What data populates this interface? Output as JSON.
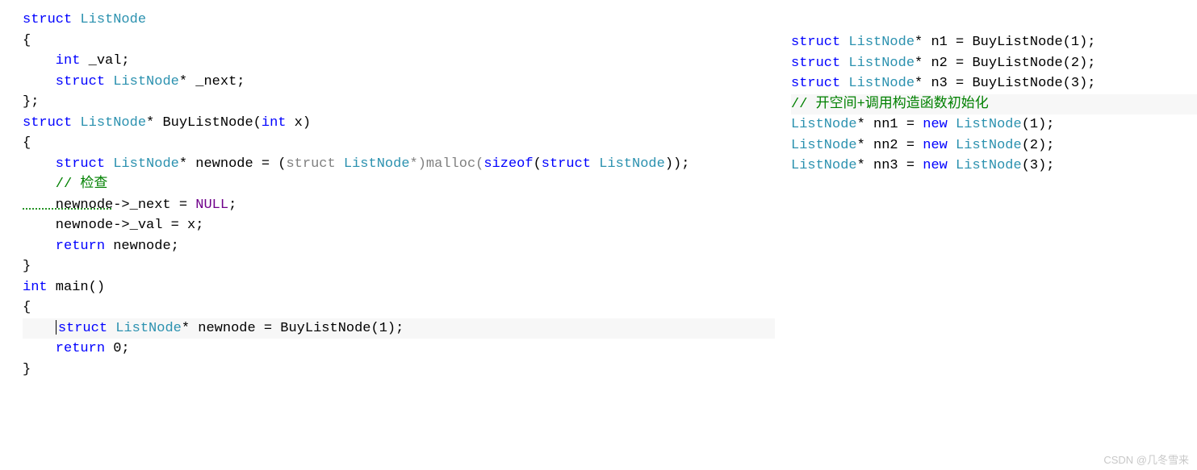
{
  "left": {
    "l1_kw": "struct",
    "l1_type": " ListNode",
    "l2": "{",
    "l3_kw": "    int",
    "l3_rest": " _val;",
    "l4_kw": "    struct",
    "l4_type": " ListNode",
    "l4_rest": "* _next;",
    "l5": "};",
    "l6": "",
    "l7_kw": "struct",
    "l7_type": " ListNode",
    "l7_rest1": "* BuyListNode(",
    "l7_kw2": "int",
    "l7_rest2": " x)",
    "l8": "{",
    "l9_kw": "    struct",
    "l9_type": " ListNode",
    "l9_rest1": "* newnode = (",
    "l9_kw2": "struct",
    "l9_type2": " ListNode",
    "l9_rest2": "*)malloc(",
    "l9_sizeof": "sizeof",
    "l9_rest3": "(",
    "l9_kw3": "struct",
    "l9_type3": " ListNode",
    "l9_rest4": "));",
    "l10": "    // 检查",
    "l11_a": "    newnode",
    "l11_b": "->_next = ",
    "l11_null": "NULL",
    "l11_c": ";",
    "l12": "    newnode->_val = x;",
    "l13": "",
    "l14_kw": "    return",
    "l14_rest": " newnode;",
    "l15": "}",
    "l16": "",
    "l17_kw": "int",
    "l17_rest": " main()",
    "l18": "{",
    "l19_pre": "    ",
    "l19_kw": "struct",
    "l19_type": " ListNode",
    "l19_rest": "* newnode = BuyListNode(1);",
    "l20": "",
    "l21_kw": "    return",
    "l21_rest": " 0;",
    "l22": "}"
  },
  "right": {
    "r1_kw": "struct",
    "r1_type": " ListNode",
    "r1_rest": "* n1 = BuyListNode(1);",
    "r2_kw": "struct",
    "r2_type": " ListNode",
    "r2_rest": "* n2 = BuyListNode(2);",
    "r3_kw": "struct",
    "r3_type": " ListNode",
    "r3_rest": "* n3 = BuyListNode(3);",
    "r4": "",
    "r5": "// 开空间+调用构造函数初始化",
    "r6_type": "ListNode",
    "r6_rest1": "* nn1 = ",
    "r6_new": "new",
    "r6_type2": " ListNode",
    "r6_rest2": "(1);",
    "r7_type": "ListNode",
    "r7_rest1": "* nn2 = ",
    "r7_new": "new",
    "r7_type2": " ListNode",
    "r7_rest2": "(2);",
    "r8_type": "ListNode",
    "r8_rest1": "* nn3 = ",
    "r8_new": "new",
    "r8_type2": " ListNode",
    "r8_rest2": "(3);"
  },
  "watermark": "CSDN @几冬雪来"
}
